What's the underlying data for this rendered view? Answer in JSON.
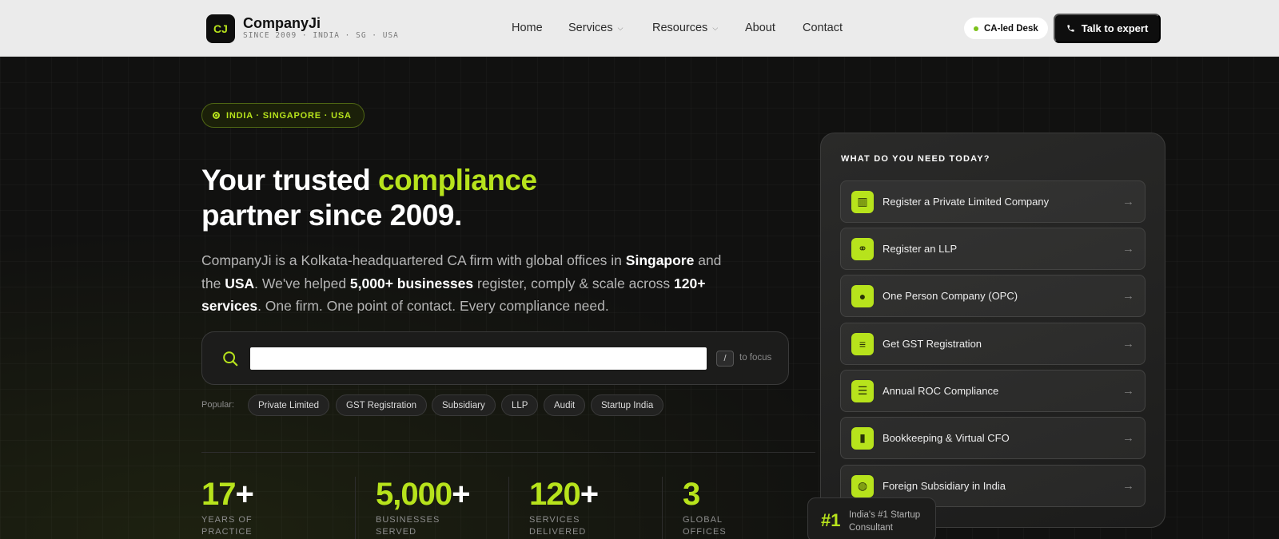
{
  "brand": {
    "logo_initials": "CJ",
    "name": "CompanyJi",
    "tagline": "SINCE 2009 · INDIA · SG · USA"
  },
  "nav": {
    "links": [
      {
        "label": "Home",
        "has_dropdown": false
      },
      {
        "label": "Services",
        "has_dropdown": true
      },
      {
        "label": "Resources",
        "has_dropdown": true
      },
      {
        "label": "About",
        "has_dropdown": false
      },
      {
        "label": "Contact",
        "has_dropdown": false
      }
    ],
    "desk_chip": "CA-led Desk",
    "cta_label": "Talk to expert"
  },
  "hero": {
    "region_pill": "INDIA · SINGAPORE · USA",
    "headline_part1": "Your trusted ",
    "headline_accent": "compliance",
    "headline_line2": "partner since 2009.",
    "desc": {
      "t1": "CompanyJi is a Kolkata-headquartered CA firm with global offices in ",
      "b1": "Singapore",
      "t2": " and the ",
      "b2": "USA",
      "t3": ". We've helped ",
      "b3": "5,000+ businesses",
      "t4": " register, comply & scale across ",
      "b4": "120+ services",
      "t5": ". One firm. One point of contact. Every compliance need."
    }
  },
  "search": {
    "value": "",
    "placeholder": "",
    "shortcut_key": "/",
    "shortcut_hint": "to focus"
  },
  "popular": {
    "label": "Popular:",
    "tags": [
      "Private Limited",
      "GST Registration",
      "Subsidiary",
      "LLP",
      "Audit",
      "Startup India"
    ]
  },
  "stats": [
    {
      "value": "17",
      "suffix": "+",
      "label_line1": "YEARS OF",
      "label_line2": "PRACTICE"
    },
    {
      "value": "5,000",
      "suffix": "+",
      "label_line1": "BUSINESSES",
      "label_line2": "SERVED"
    },
    {
      "value": "120",
      "suffix": "+",
      "label_line1": "SERVICES",
      "label_line2": "DELIVERED"
    },
    {
      "value": "3",
      "suffix": "",
      "label_line1": "GLOBAL",
      "label_line2": "OFFICES"
    }
  ],
  "panel": {
    "title": "WHAT DO YOU NEED TODAY?",
    "services": [
      {
        "label": "Register a Private Limited Company",
        "icon": "building-icon",
        "glyph": "▥"
      },
      {
        "label": "Register an LLP",
        "icon": "handshake-icon",
        "glyph": "⚭"
      },
      {
        "label": "One Person Company (OPC)",
        "icon": "person-icon",
        "glyph": "●"
      },
      {
        "label": "Get GST Registration",
        "icon": "receipt-icon",
        "glyph": "≡"
      },
      {
        "label": "Annual ROC Compliance",
        "icon": "clipboard-icon",
        "glyph": "☰"
      },
      {
        "label": "Bookkeeping & Virtual CFO",
        "icon": "bar-chart-icon",
        "glyph": "▮"
      },
      {
        "label": "Foreign Subsidiary in India",
        "icon": "globe-icon",
        "glyph": "◍"
      }
    ],
    "arrow": "→"
  },
  "badge": {
    "number": "#1",
    "text": "India's #1 Startup Consultant"
  },
  "colors": {
    "accent": "#b7e31c",
    "nav_bg": "#ebebeb",
    "hero_bg": "#111110",
    "cta_bg": "#0e0e0e"
  }
}
